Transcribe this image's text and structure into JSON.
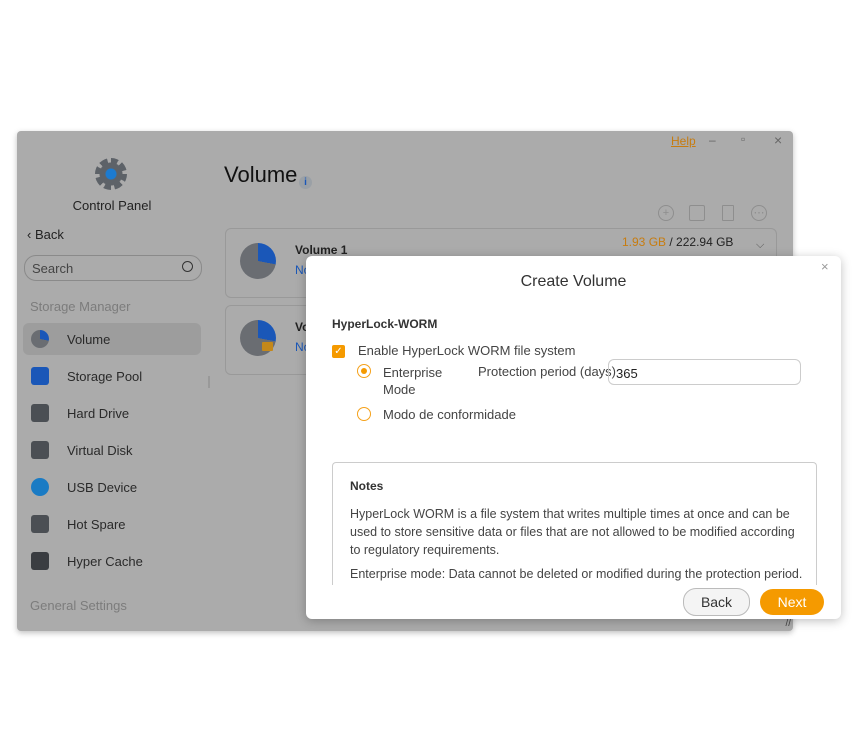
{
  "window": {
    "help": "Help",
    "minimize": "–",
    "maximize": "▫",
    "close": "×"
  },
  "sidebar": {
    "app_title": "Control Panel",
    "back": "Back",
    "search_placeholder": "Search",
    "section_storage": "Storage Manager",
    "items": [
      {
        "label": "Volume",
        "icon": "volume-pie-icon"
      },
      {
        "label": "Storage Pool",
        "icon": "storage-pool-icon"
      },
      {
        "label": "Hard Drive",
        "icon": "hard-drive-icon"
      },
      {
        "label": "Virtual Disk",
        "icon": "virtual-disk-icon"
      },
      {
        "label": "USB Device",
        "icon": "usb-icon"
      },
      {
        "label": "Hot Spare",
        "icon": "hot-spare-icon"
      },
      {
        "label": "Hyper Cache",
        "icon": "hyper-cache-icon"
      }
    ],
    "section_general": "General Settings"
  },
  "main": {
    "title": "Volume",
    "volumes": [
      {
        "name": "Volume 1",
        "status": "No",
        "used": "1.93 GB",
        "total": "222.94 GB"
      },
      {
        "name": "Vo",
        "status": "No"
      }
    ]
  },
  "dialog": {
    "title": "Create Volume",
    "close": "×",
    "section": "HyperLock-WORM",
    "enable_label": "Enable HyperLock WORM file system",
    "enable_checked": true,
    "enterprise_label": "Enterprise Mode",
    "compliance_label": "Modo de conformidade",
    "selected_mode": "enterprise",
    "period_label": "Protection period (days)",
    "period_value": "365",
    "notes_title": "Notes",
    "notes_p1": "HyperLock WORM is a file system that writes multiple times at once and can be used to store sensitive data or files that are not allowed to be modified according to regulatory requirements.",
    "notes_p2": "Enterprise mode: Data cannot be deleted or modified during the protection period.",
    "back": "Back",
    "next": "Next"
  },
  "colors": {
    "accent": "#f59a00",
    "link_blue": "#1a57b8"
  }
}
